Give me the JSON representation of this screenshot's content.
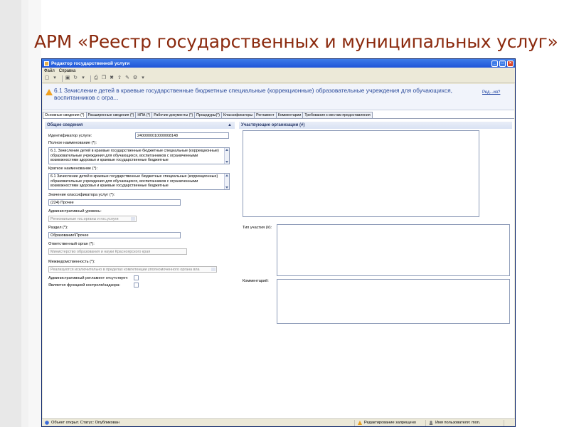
{
  "slide": {
    "title": "АРМ «Реестр государственных и муниципальных услуг»"
  },
  "window": {
    "title": "Редактор государственной услуги"
  },
  "menu": [
    "Файл",
    "Справка"
  ],
  "service": {
    "title": "6.1 Зачисление детей в краевые государственные бюджетные специальные (коррекционные) образовательные учреждения для обучающихся, воспитанников с огра...",
    "help_link": "Ред...ия?"
  },
  "tabs": [
    "Основные сведения (*)",
    "Расширенные сведения (*)",
    "НПА (*)",
    "Рабочие документы (*)",
    "Процедуры(*)",
    "Классификаторы",
    "Регламент",
    "Комментарии",
    "Требования к местам предоставления"
  ],
  "general": {
    "header": "Общие сведения",
    "collapse": "▲",
    "id_label": "Идентификатор услуги:",
    "id_value": "2400000010000008148",
    "full_name_label": "Полное наименование (*):",
    "full_name_value": "6.1. Зачисление детей в краевые государственные бюджетные специальные (коррекционные) образовательные учреждения для обучающихся, воспитанников с ограниченными возможностями здоровья и краевые государственные бюджетные",
    "short_name_label": "Краткое наименование (*):",
    "short_name_value": "6.1 Зачисление детей в краевые государственные бюджетные специальные (коррекционные) образовательные учреждения для обучающихся, воспитанников с ограниченными возможностями здоровья и краевые государственные бюджетные",
    "classifier_label": "Значение классификатора услуг (*):",
    "classifier_value": "(224) Прочее",
    "admin_level_label": "Административный уровень:",
    "admin_level_value": "Региональные гос.органы и гос.услуги",
    "section_label": "Раздел (*):",
    "section_value": "Образование\\Прочее",
    "responsible_label": "Ответственный орган (*):",
    "responsible_value": "Министерство образования и науки Красноярского края",
    "interagency_label": "Межведомственность (*):",
    "interagency_value": "Реализуются исключительно в пределах компетенции уполномоченного органа вла",
    "no_reg_label": "Административный регламент отсутствует:",
    "control_label": "Является функцией контроля/надзора:"
  },
  "participants": {
    "header": "Участвующие организации (#)",
    "type_label": "Тип участия (#):",
    "comment_label": "Комментарий:"
  },
  "status": {
    "object": "Объект открыт. Статус: Опубликован",
    "editing": "Редактирование запрещено",
    "user": "Имя пользователя: mon."
  }
}
